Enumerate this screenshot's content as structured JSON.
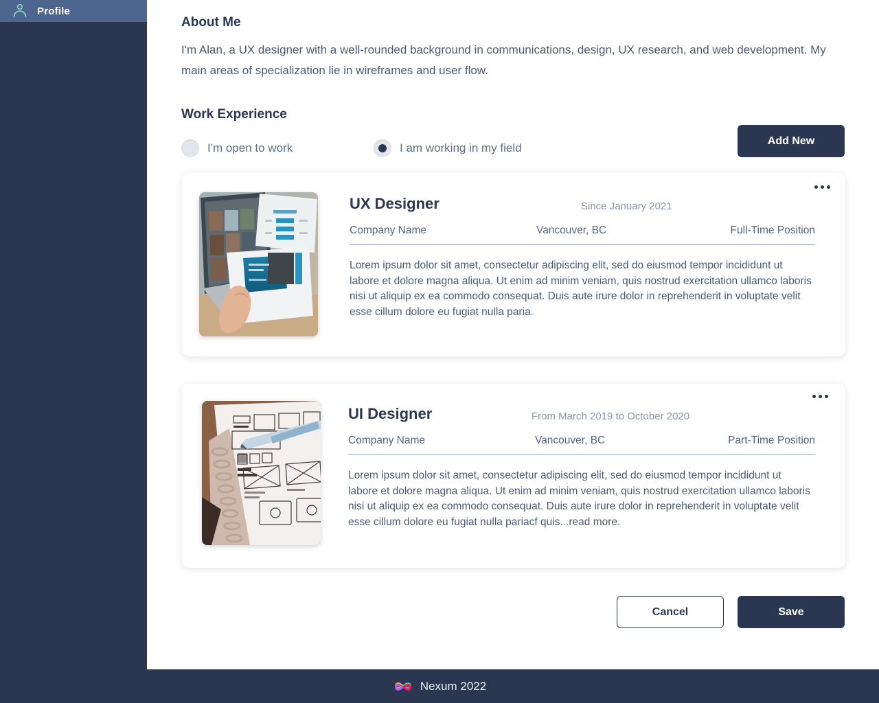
{
  "sidebar": {
    "items": [
      {
        "id": "profile",
        "label": "Profile",
        "icon": "person-icon",
        "active": true
      }
    ]
  },
  "main": {
    "about": {
      "title": "About Me",
      "text": "I'm Alan, a UX designer with a well-rounded background in communications, design, UX research, and web development. My main areas of specialization lie in wireframes and user flow."
    },
    "work": {
      "title": "Work Experience",
      "radios": [
        {
          "id": "open-to-work",
          "label": "I'm open to work",
          "checked": false
        },
        {
          "id": "working-in-field",
          "label": "I am working in my field",
          "checked": true
        }
      ],
      "add_new_label": "Add New",
      "experiences": [
        {
          "title": "UX Designer",
          "date": "Since January 2021",
          "company": "Company Name",
          "location": "Vancouver, BC",
          "type": "Full-Time Position",
          "description": "Lorem ipsum dolor sit amet, consectetur adipiscing elit, sed do eiusmod tempor incididunt ut labore et dolore magna aliqua. Ut enim ad minim veniam, quis nostrud exercitation ullamco laboris nisi ut aliquip ex ea commodo consequat. Duis aute irure dolor in reprehenderit in voluptate velit esse cillum dolore eu fugiat nulla paria.",
          "thumb_alt": "laptop-and-printed-design-documents-photo",
          "menu_icon": "kebab-menu-icon"
        },
        {
          "title": "UI Designer",
          "date": "From March 2019 to October 2020",
          "company": "Company Name",
          "location": "Vancouver, BC",
          "type": "Part-Time Position",
          "description": "Lorem ipsum dolor sit amet, consectetur adipiscing elit, sed do eiusmod tempor incididunt ut labore et dolore magna aliqua. Ut enim ad minim veniam, quis nostrud exercitation ullamco laboris nisi ut aliquip ex ea commodo consequat. Duis aute irure dolor in reprehenderit in voluptate velit esse cillum dolore eu fugiat nulla pariacf quis...read more.",
          "thumb_alt": "wireframe-sketch-notebook-photo",
          "menu_icon": "kebab-menu-icon"
        }
      ]
    },
    "actions": {
      "cancel_label": "Cancel",
      "save_label": "Save"
    }
  },
  "footer": {
    "brand": "Nexum 2022",
    "logo_icon": "nexum-loops-logo-icon"
  },
  "colors": {
    "navy": "#2b3651",
    "sidebar_active": "#4e6590",
    "panel": "#ffffff",
    "muted_text": "#8b96a8",
    "body_text": "#4b5a72",
    "icon_mint": "#8fdcc0"
  }
}
